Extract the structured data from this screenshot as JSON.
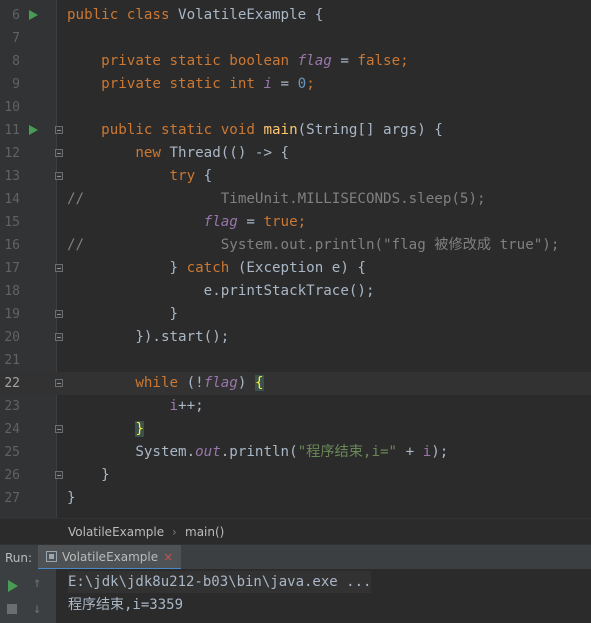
{
  "editor": {
    "lines": [
      {
        "num": "6"
      },
      {
        "num": "7"
      },
      {
        "num": "8"
      },
      {
        "num": "9"
      },
      {
        "num": "10"
      },
      {
        "num": "11"
      },
      {
        "num": "12"
      },
      {
        "num": "13"
      },
      {
        "num": "14"
      },
      {
        "num": "15"
      },
      {
        "num": "16"
      },
      {
        "num": "17"
      },
      {
        "num": "18"
      },
      {
        "num": "19"
      },
      {
        "num": "20"
      },
      {
        "num": "21"
      },
      {
        "num": "22"
      },
      {
        "num": "23"
      },
      {
        "num": "24"
      },
      {
        "num": "25"
      },
      {
        "num": "26"
      },
      {
        "num": "27"
      }
    ],
    "code": {
      "l6": [
        "public class ",
        "VolatileExample {"
      ],
      "l8": [
        "    private static boolean ",
        "flag",
        " = ",
        "false",
        ";"
      ],
      "l9": [
        "    private static int ",
        "i",
        " = ",
        "0",
        ";"
      ],
      "l11": [
        "    public static void ",
        "main",
        "(String[] args) {"
      ],
      "l12": [
        "        new ",
        "Thread(() -> {"
      ],
      "l13": [
        "            ",
        "try",
        " {"
      ],
      "l14": [
        "//",
        "                TimeUnit.MILLISECONDS.sleep(5);"
      ],
      "l15": [
        "                ",
        "flag",
        " = ",
        "true",
        ";"
      ],
      "l16": [
        "//",
        "                System.out.println(\"flag 被修改成 true\");"
      ],
      "l17": [
        "            } ",
        "catch",
        " (Exception e) {"
      ],
      "l18": [
        "                e.printStackTrace();"
      ],
      "l19": [
        "            }"
      ],
      "l20": [
        "        }).start();"
      ],
      "l22": [
        "        ",
        "while",
        " (!",
        "flag",
        ") ",
        "{"
      ],
      "l23": [
        "            ",
        "i",
        "++;"
      ],
      "l24": [
        "        ",
        "}"
      ],
      "l25": [
        "        System.",
        "out",
        ".println(",
        "\"程序结束,i=\"",
        " + ",
        "i",
        ");"
      ],
      "l26": [
        "    }"
      ],
      "l27": [
        "}"
      ]
    }
  },
  "breadcrumb": {
    "class": "VolatileExample",
    "sep": "›",
    "method": "main()"
  },
  "run": {
    "label": "Run:",
    "tab": "VolatileExample",
    "close": "×",
    "console": {
      "cmd": "E:\\jdk\\jdk8u212-b03\\bin\\java.exe ...",
      "output": "程序结束,i=3359"
    }
  }
}
